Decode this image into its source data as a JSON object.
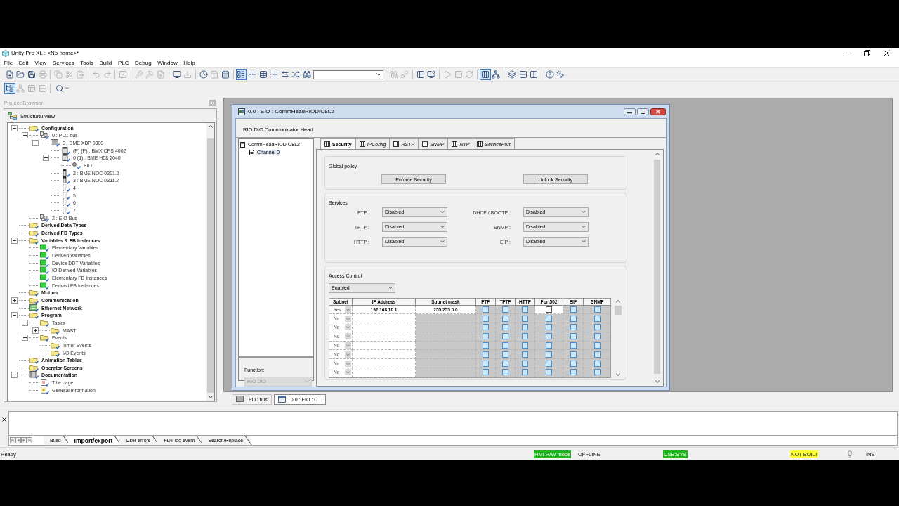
{
  "window": {
    "title": "Unity Pro XL : <No name>*"
  },
  "menu": [
    "File",
    "Edit",
    "View",
    "Services",
    "Tools",
    "Build",
    "PLC",
    "Debug",
    "Window",
    "Help"
  ],
  "toolbars": [
    [
      [
        {
          "kind": "new",
          "pressed": false,
          "disabled": false
        },
        {
          "kind": "open",
          "pressed": false,
          "disabled": false
        },
        {
          "kind": "save",
          "pressed": false,
          "disabled": false
        },
        {
          "kind": "print",
          "pressed": false,
          "disabled": true
        }
      ],
      [
        {
          "kind": "copy",
          "pressed": false,
          "disabled": true
        },
        {
          "kind": "cut",
          "pressed": false,
          "disabled": true
        },
        {
          "kind": "paste",
          "pressed": false,
          "disabled": true
        }
      ],
      [
        {
          "kind": "undo",
          "pressed": false,
          "disabled": true
        },
        {
          "kind": "redo",
          "pressed": false,
          "disabled": true
        }
      ],
      [
        {
          "kind": "validate",
          "pressed": false,
          "disabled": true
        }
      ],
      [
        {
          "kind": "analyze",
          "pressed": false,
          "disabled": true
        },
        {
          "kind": "build",
          "pressed": false,
          "disabled": true
        },
        {
          "kind": "find",
          "pressed": false,
          "disabled": true
        }
      ],
      [
        {
          "kind": "screen",
          "pressed": false,
          "disabled": false
        },
        {
          "kind": "import",
          "pressed": false,
          "disabled": true
        }
      ],
      [
        {
          "kind": "clock",
          "pressed": false,
          "disabled": false
        },
        {
          "kind": "calendar",
          "pressed": false,
          "disabled": true
        },
        {
          "kind": "schedule",
          "pressed": false,
          "disabled": false
        }
      ],
      [
        {
          "kind": "browser",
          "pressed": true,
          "disabled": false
        },
        {
          "kind": "tree",
          "pressed": false,
          "disabled": false
        },
        {
          "kind": "table",
          "pressed": false,
          "disabled": false
        },
        {
          "kind": "list",
          "pressed": false,
          "disabled": false
        },
        {
          "kind": "transfer",
          "pressed": false,
          "disabled": false
        },
        {
          "kind": "shuffle",
          "pressed": false,
          "disabled": false
        },
        {
          "kind": "binoculars",
          "pressed": false,
          "disabled": false
        },
        {
          "kind": "combo",
          "disabled": false
        }
      ],
      [
        {
          "kind": "connect",
          "pressed": false,
          "disabled": true
        },
        {
          "kind": "disconnect",
          "pressed": false,
          "disabled": true
        }
      ],
      [
        {
          "kind": "panel",
          "pressed": false,
          "disabled": false
        },
        {
          "kind": "monitor",
          "pressed": false,
          "disabled": false
        }
      ],
      [
        {
          "kind": "run",
          "pressed": false,
          "disabled": true
        },
        {
          "kind": "stop",
          "pressed": false,
          "disabled": true
        },
        {
          "kind": "refresh",
          "pressed": false,
          "disabled": true
        }
      ],
      [
        {
          "kind": "animation",
          "pressed": true,
          "disabled": false
        },
        {
          "kind": "network",
          "pressed": false,
          "disabled": false
        }
      ],
      [
        {
          "kind": "cascade",
          "pressed": false,
          "disabled": false
        },
        {
          "kind": "tile_h",
          "pressed": false,
          "disabled": false
        },
        {
          "kind": "tile_v",
          "pressed": false,
          "disabled": false
        }
      ],
      [
        {
          "kind": "help",
          "pressed": false,
          "disabled": false
        },
        {
          "kind": "help_pointer",
          "pressed": false,
          "disabled": false
        }
      ]
    ],
    [
      [
        {
          "kind": "project_tree",
          "pressed": true,
          "disabled": false
        },
        {
          "kind": "hierarchy",
          "pressed": false,
          "disabled": true
        },
        {
          "kind": "panels",
          "pressed": false,
          "disabled": true
        },
        {
          "kind": "rows",
          "pressed": false,
          "disabled": true
        }
      ],
      [
        {
          "kind": "zoom",
          "pressed": false,
          "disabled": false
        }
      ]
    ]
  ],
  "project_browser": {
    "title": "Project Browser",
    "view": "Structural view",
    "tree": [
      {
        "label": "Configuration",
        "kind": "folder",
        "expanded": true,
        "children": [
          {
            "label": "0 : PLC bus",
            "kind": "bus",
            "expanded": true,
            "children": [
              {
                "label": "0 : BME XBP 0800",
                "kind": "rack",
                "expanded": true,
                "children": [
                  {
                    "label": "(P) (P) : BMX CPS 4002",
                    "kind": "module"
                  },
                  {
                    "label": "0 (1) : BME H58 2040",
                    "kind": "module",
                    "expanded": true,
                    "children": [
                      {
                        "label": "EIO",
                        "kind": "port"
                      }
                    ]
                  },
                  {
                    "label": "2 : BME NOC 0301.2",
                    "kind": "card"
                  },
                  {
                    "label": "3 : BME NOC 0311.2",
                    "kind": "card"
                  },
                  {
                    "label": "4",
                    "kind": "slot"
                  },
                  {
                    "label": "5",
                    "kind": "slot"
                  },
                  {
                    "label": "6",
                    "kind": "slot"
                  },
                  {
                    "label": "7",
                    "kind": "slot"
                  }
                ]
              }
            ]
          },
          {
            "label": "2 : EIO Bus",
            "kind": "bus"
          }
        ]
      },
      {
        "label": "Derived Data Types",
        "kind": "folder"
      },
      {
        "label": "Derived FB Types",
        "kind": "folder"
      },
      {
        "label": "Variables & FB instances",
        "kind": "folder",
        "expanded": true,
        "children": [
          {
            "label": "Elementary Variables",
            "kind": "variable"
          },
          {
            "label": "Derived Variables",
            "kind": "variable"
          },
          {
            "label": "Device DDT Variables",
            "kind": "variable"
          },
          {
            "label": "IO Derived Variables",
            "kind": "variable"
          },
          {
            "label": "Elementary FB Instances",
            "kind": "variable"
          },
          {
            "label": "Derived FB Instances",
            "kind": "variable"
          }
        ]
      },
      {
        "label": "Motion",
        "kind": "folder"
      },
      {
        "label": "Communication",
        "kind": "folder",
        "expanded": false
      },
      {
        "label": "Ethernet Network",
        "kind": "network"
      },
      {
        "label": "Program",
        "kind": "folder",
        "expanded": true,
        "children": [
          {
            "label": "Tasks",
            "kind": "folder",
            "expanded": true,
            "children": [
              {
                "label": "MAST",
                "kind": "folder",
                "expanded": false
              }
            ]
          },
          {
            "label": "Events",
            "kind": "folder",
            "expanded": true,
            "children": [
              {
                "label": "Timer Events",
                "kind": "folder"
              },
              {
                "label": "I/O Events",
                "kind": "folder"
              }
            ]
          }
        ]
      },
      {
        "label": "Animation Tables",
        "kind": "folder"
      },
      {
        "label": "Operator Screens",
        "kind": "folder"
      },
      {
        "label": "Documentation",
        "kind": "book",
        "expanded": true,
        "children": [
          {
            "label": "Title page",
            "kind": "page"
          },
          {
            "label": "General Information",
            "kind": "info"
          }
        ]
      }
    ]
  },
  "config_window": {
    "title": "0.0 : EIO : CommHeadRIODIO8L2",
    "description": "RIO DIO Communicator Head",
    "tree": [
      {
        "label": "CommHeadRIODIO8L2",
        "selected": false,
        "children": [
          {
            "label": "Channel 0",
            "selected": true
          }
        ]
      }
    ],
    "function": {
      "label": "Function:",
      "value": "RIO DIO",
      "disabled": true
    },
    "tabs": [
      {
        "label": "Security",
        "selected": true
      },
      {
        "label": "IPConfig",
        "selected": false
      },
      {
        "label": "RSTP",
        "selected": false
      },
      {
        "label": "SNMP",
        "selected": false
      },
      {
        "label": "NTP",
        "selected": false
      },
      {
        "label": "ServicePort",
        "selected": false
      }
    ],
    "global_policy": {
      "title": "Global policy",
      "buttons": [
        "Enforce Security",
        "Unlock Security"
      ]
    },
    "services": {
      "title": "Services",
      "fields": [
        {
          "label": "FTP :",
          "value": "Disabled"
        },
        {
          "label": "DHCP / BOOTP :",
          "value": "Disabled"
        },
        {
          "label": "TFTP :",
          "value": "Disabled"
        },
        {
          "label": "SNMP :",
          "value": "Disabled"
        },
        {
          "label": "HTTP :",
          "value": "Disabled"
        },
        {
          "label": "EIP :",
          "value": "Disabled"
        }
      ]
    },
    "access_control": {
      "title": "Access Control",
      "mode": "Enabled",
      "table": {
        "columns": [
          "Subnet",
          "IP Address",
          "Subnet mask",
          "FTP",
          "TFTP",
          "HTTP",
          "Port502",
          "EIP",
          "SNMP"
        ],
        "rows": [
          {
            "subnet": "Yes",
            "ip": "192.168.10.1",
            "mask": "255.255.0.0",
            "mask_disabled": false,
            "services": [
              {
                "checked": false,
                "disabled": true
              },
              {
                "checked": false,
                "disabled": true
              },
              {
                "checked": false,
                "disabled": true
              },
              {
                "checked": false,
                "disabled": false
              },
              {
                "checked": false,
                "disabled": true
              },
              {
                "checked": false,
                "disabled": true
              }
            ]
          },
          {
            "subnet": "No",
            "mask_disabled": true,
            "services": [
              {
                "checked": false,
                "disabled": true
              },
              {
                "checked": false,
                "disabled": true
              },
              {
                "checked": false,
                "disabled": true
              },
              {
                "checked": false,
                "disabled": true
              },
              {
                "checked": false,
                "disabled": true
              },
              {
                "checked": false,
                "disabled": true
              }
            ]
          },
          {
            "subnet": "No",
            "mask_disabled": true,
            "services": [
              {
                "checked": false,
                "disabled": true
              },
              {
                "checked": false,
                "disabled": true
              },
              {
                "checked": false,
                "disabled": true
              },
              {
                "checked": false,
                "disabled": true
              },
              {
                "checked": false,
                "disabled": true
              },
              {
                "checked": false,
                "disabled": true
              }
            ]
          },
          {
            "subnet": "No",
            "mask_disabled": true,
            "services": [
              {
                "checked": false,
                "disabled": true
              },
              {
                "checked": false,
                "disabled": true
              },
              {
                "checked": false,
                "disabled": true
              },
              {
                "checked": false,
                "disabled": true
              },
              {
                "checked": false,
                "disabled": true
              },
              {
                "checked": false,
                "disabled": true
              }
            ]
          },
          {
            "subnet": "No",
            "mask_disabled": true,
            "services": [
              {
                "checked": false,
                "disabled": true
              },
              {
                "checked": false,
                "disabled": true
              },
              {
                "checked": false,
                "disabled": true
              },
              {
                "checked": false,
                "disabled": true
              },
              {
                "checked": false,
                "disabled": true
              },
              {
                "checked": false,
                "disabled": true
              }
            ]
          },
          {
            "subnet": "No",
            "mask_disabled": true,
            "services": [
              {
                "checked": false,
                "disabled": true
              },
              {
                "checked": false,
                "disabled": true
              },
              {
                "checked": false,
                "disabled": true
              },
              {
                "checked": false,
                "disabled": true
              },
              {
                "checked": false,
                "disabled": true
              },
              {
                "checked": false,
                "disabled": true
              }
            ]
          },
          {
            "subnet": "No",
            "mask_disabled": true,
            "services": [
              {
                "checked": false,
                "disabled": true
              },
              {
                "checked": false,
                "disabled": true
              },
              {
                "checked": false,
                "disabled": true
              },
              {
                "checked": false,
                "disabled": true
              },
              {
                "checked": false,
                "disabled": true
              },
              {
                "checked": false,
                "disabled": true
              }
            ]
          },
          {
            "subnet": "No",
            "mask_disabled": true,
            "services": [
              {
                "checked": false,
                "disabled": true
              },
              {
                "checked": false,
                "disabled": true
              },
              {
                "checked": false,
                "disabled": true
              },
              {
                "checked": false,
                "disabled": true
              },
              {
                "checked": false,
                "disabled": true
              },
              {
                "checked": false,
                "disabled": true
              }
            ]
          }
        ]
      }
    }
  },
  "document_tabs": [
    {
      "label": "PLC bus",
      "kind": "rack",
      "selected": false
    },
    {
      "label": "0.0 : EIO : C...",
      "kind": "window",
      "selected": true
    }
  ],
  "output": {
    "tabs": [
      {
        "label": "Build",
        "selected": false
      },
      {
        "label": "Import/export",
        "selected": true
      },
      {
        "label": "User errors",
        "selected": false
      },
      {
        "label": "FDT log event",
        "selected": false
      },
      {
        "label": "Search/Replace",
        "selected": false
      }
    ]
  },
  "status_bar": [
    {
      "kind": "text",
      "text": "Ready"
    },
    {
      "kind": "badge",
      "text": "HMI R/W mode",
      "color": "#1fb21f"
    },
    {
      "kind": "text",
      "text": "OFFLINE"
    },
    {
      "kind": "badge",
      "text": "USB:SYS",
      "color": "#1fb21f"
    },
    {
      "kind": "badge",
      "text": "NOT BUILT",
      "color": "#ffff38"
    },
    {
      "kind": "bulb"
    },
    {
      "kind": "text",
      "text": "INS"
    }
  ]
}
